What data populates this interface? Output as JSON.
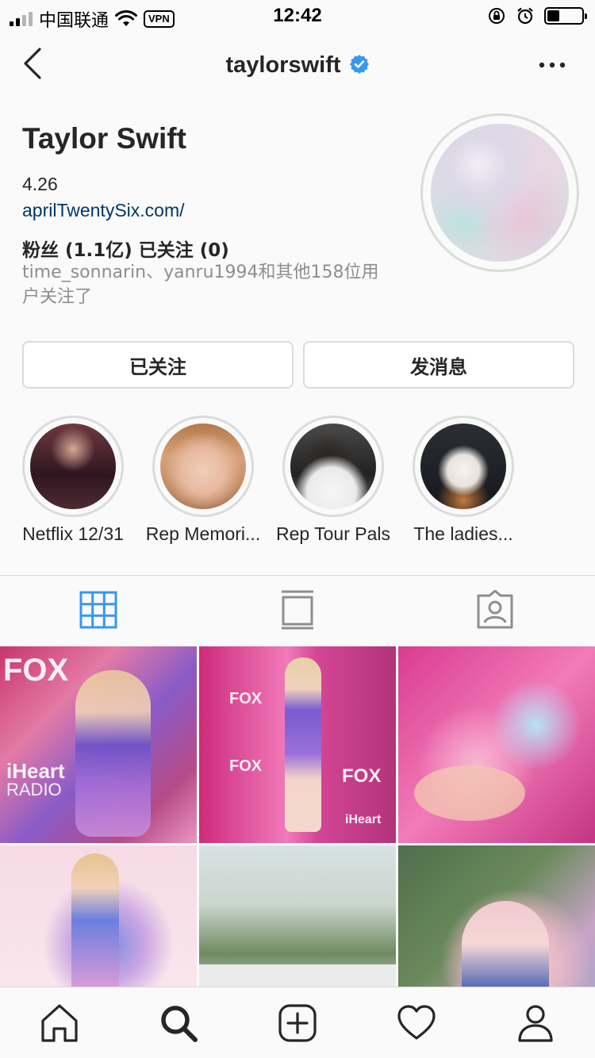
{
  "status_bar": {
    "carrier": "中国联通",
    "vpn": "VPN",
    "time": "12:42",
    "battery_level": 0.35
  },
  "header": {
    "username": "taylorswift",
    "verified": true
  },
  "profile": {
    "name": "Taylor Swift",
    "bio_line": "4.26",
    "website": "aprilTwentySix.com/",
    "counts": "粉丝 (1.1亿) 已关注 (0)",
    "followed_by": "time_sonnarin、yanru1994和其他158位用户关注了"
  },
  "actions": {
    "follow_label": "已关注",
    "message_label": "发消息"
  },
  "highlights": [
    {
      "label": "Netflix 12/31"
    },
    {
      "label": "Rep Memori..."
    },
    {
      "label": "Rep Tour Pals"
    },
    {
      "label": "The ladies..."
    }
  ],
  "tabs": [
    {
      "icon": "grid-icon",
      "active": true
    },
    {
      "icon": "feed-icon",
      "active": false
    },
    {
      "icon": "tagged-icon",
      "active": false
    }
  ],
  "grid_texts": {
    "fox": "FOX",
    "iheart": "iHeart",
    "radio": "RADIO"
  },
  "bottom_nav": [
    {
      "icon": "home-icon"
    },
    {
      "icon": "search-icon"
    },
    {
      "icon": "add-post-icon"
    },
    {
      "icon": "heart-icon"
    },
    {
      "icon": "profile-icon"
    }
  ],
  "colors": {
    "accent": "#3897f0",
    "link": "#00376b",
    "muted": "#8e8e8e",
    "border": "#dbdbdb"
  }
}
